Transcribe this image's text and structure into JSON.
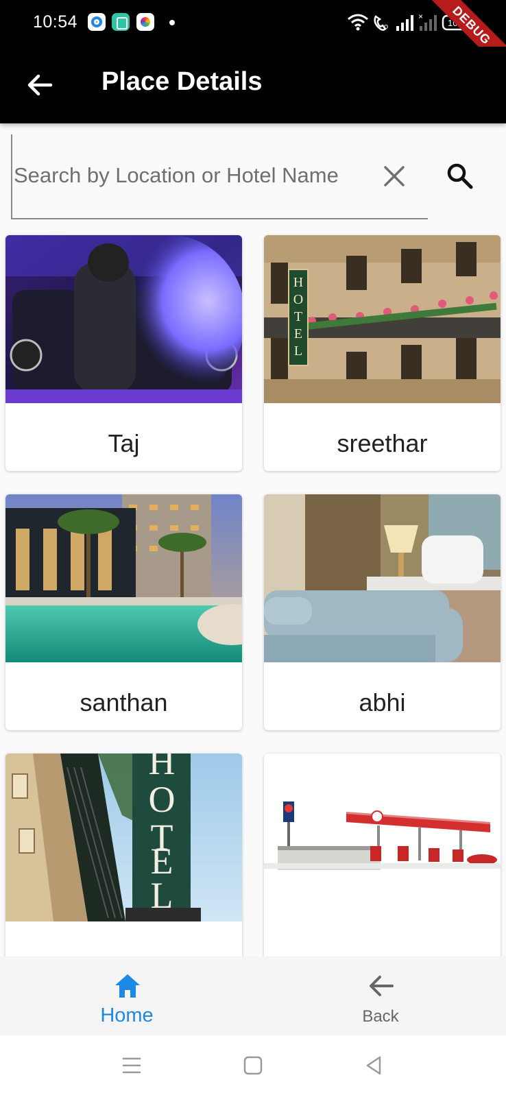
{
  "status_bar": {
    "time": "10:54",
    "battery": "100",
    "debug_banner": "DEBUG"
  },
  "app_bar": {
    "title": "Place Details"
  },
  "search": {
    "placeholder": "Search by Location or Hotel Name",
    "value": ""
  },
  "places": [
    {
      "name": "Taj",
      "image": "hooded-figure-car-photo"
    },
    {
      "name": "sreethar",
      "image": "hotel-facade-balconies-photo"
    },
    {
      "name": "santhan",
      "image": "resort-pool-palms-photo"
    },
    {
      "name": "abhi",
      "image": "hotel-bedroom-photo"
    },
    {
      "name": "",
      "image": "hotel-sign-building-photo"
    },
    {
      "name": "",
      "image": "gas-station-photo"
    }
  ],
  "bottom_nav": {
    "home_label": "Home",
    "back_label": "Back",
    "active_color": "#1e88e5",
    "inactive_color": "#666666"
  },
  "colors": {
    "app_bar": "#000000",
    "background": "#fafafa"
  }
}
